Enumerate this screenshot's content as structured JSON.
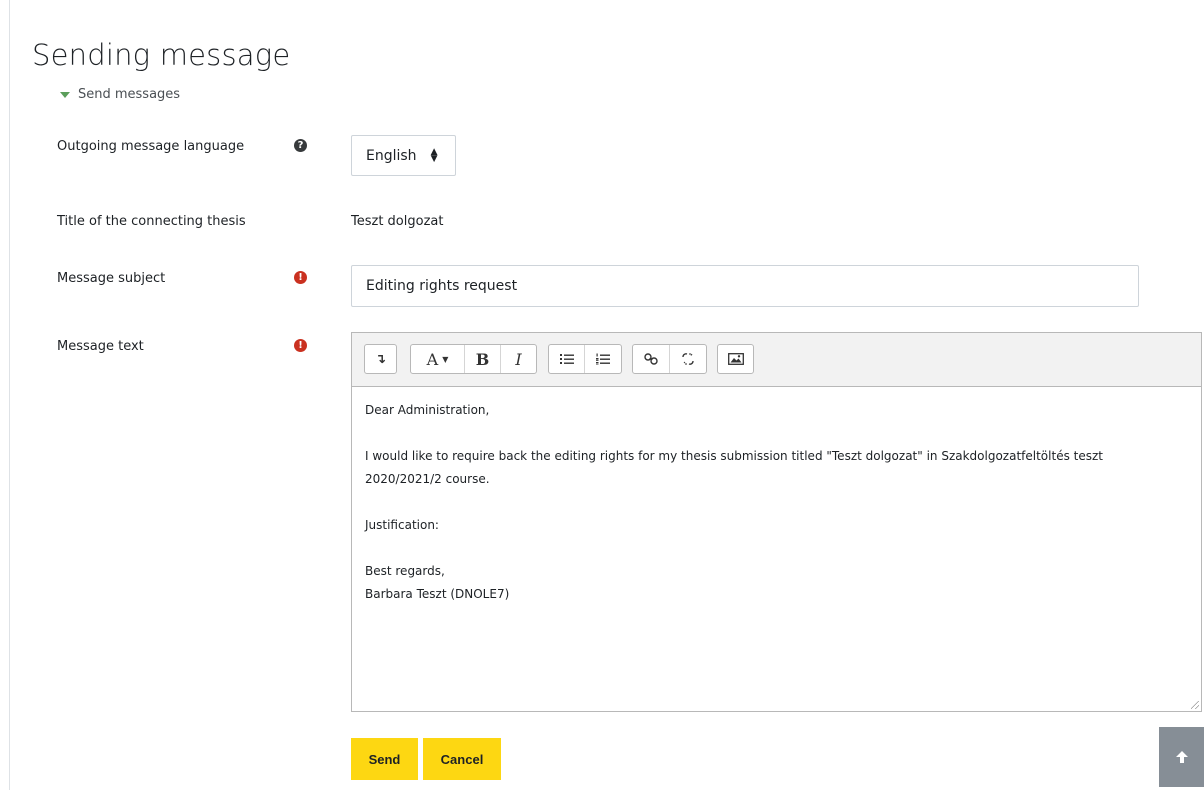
{
  "page": {
    "title": "Sending message",
    "section_label": "Send messages"
  },
  "form": {
    "language": {
      "label": "Outgoing message language",
      "value": "English",
      "help_icon": "question-circle-icon"
    },
    "thesis_title": {
      "label": "Title of the connecting thesis",
      "value": "Teszt dolgozat"
    },
    "subject": {
      "label": "Message subject",
      "value": "Editing rights request",
      "required_icon": "exclamation-circle-icon"
    },
    "message": {
      "label": "Message text",
      "required_icon": "exclamation-circle-icon",
      "lines": {
        "greeting": "Dear Administration,",
        "body_1": "I would like to require back the editing rights for my thesis submission titled \"Teszt dolgozat\" in Szakdolgozatfeltöltés teszt",
        "body_2": "2020/2021/2 course.",
        "justification": "Justification:",
        "closing": "Best regards,",
        "signature": "Barbara Teszt (DNOLE7)"
      }
    }
  },
  "toolbar": {
    "expand": "↴",
    "font": "A",
    "bold": "B",
    "italic": "I"
  },
  "actions": {
    "send": "Send",
    "cancel": "Cancel"
  },
  "colors": {
    "accent_yellow": "#fdd712",
    "required_red": "#ca3120",
    "back_to_top": "#868e96"
  }
}
